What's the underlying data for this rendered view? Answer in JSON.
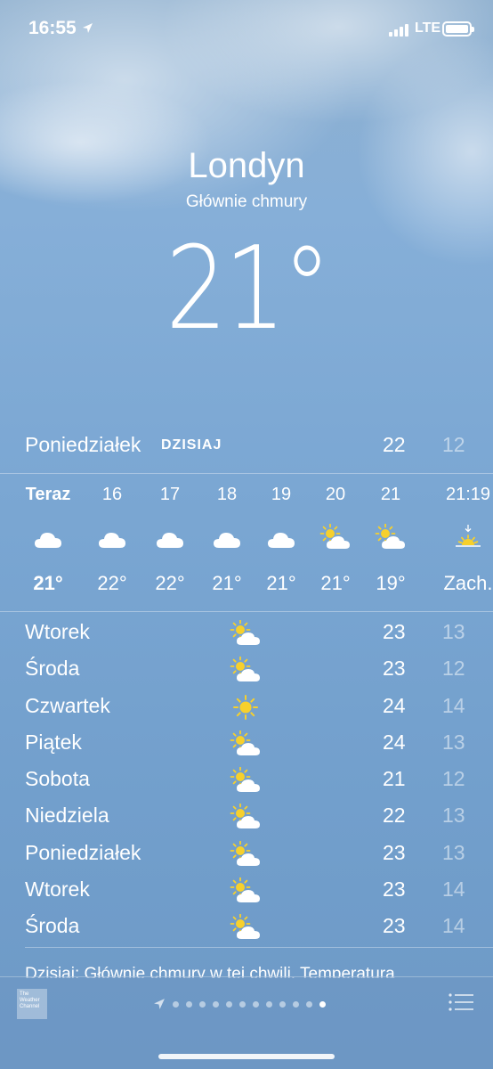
{
  "status_bar": {
    "time": "16:55",
    "network": "LTE"
  },
  "location": {
    "city": "Londyn",
    "condition": "Głównie chmury",
    "temperature": "21°"
  },
  "today": {
    "day": "Poniedziałek",
    "tag": "DZISIAJ",
    "high": "22",
    "low": "12"
  },
  "hourly": [
    {
      "label": "Teraz",
      "icon": "cloud-icon",
      "temp": "21°",
      "bold": true
    },
    {
      "label": "16",
      "icon": "cloud-icon",
      "temp": "22°"
    },
    {
      "label": "17",
      "icon": "cloud-icon",
      "temp": "22°"
    },
    {
      "label": "18",
      "icon": "cloud-icon",
      "temp": "21°"
    },
    {
      "label": "19",
      "icon": "cloud-icon",
      "temp": "21°"
    },
    {
      "label": "20",
      "icon": "partly-cloudy-icon",
      "temp": "21°"
    },
    {
      "label": "21",
      "icon": "partly-cloudy-icon",
      "temp": "19°"
    },
    {
      "label": "21:19",
      "icon": "sunset-icon",
      "temp": "Zach."
    }
  ],
  "daily": [
    {
      "day": "Wtorek",
      "icon": "partly-cloudy-icon",
      "high": "23",
      "low": "13"
    },
    {
      "day": "Środa",
      "icon": "partly-cloudy-icon",
      "high": "23",
      "low": "12"
    },
    {
      "day": "Czwartek",
      "icon": "sun-icon",
      "high": "24",
      "low": "14"
    },
    {
      "day": "Piątek",
      "icon": "partly-cloudy-icon",
      "high": "24",
      "low": "13"
    },
    {
      "day": "Sobota",
      "icon": "partly-cloudy-icon",
      "high": "21",
      "low": "12"
    },
    {
      "day": "Niedziela",
      "icon": "partly-cloudy-icon",
      "high": "22",
      "low": "13"
    },
    {
      "day": "Poniedziałek",
      "icon": "partly-cloudy-icon",
      "high": "23",
      "low": "13"
    },
    {
      "day": "Wtorek",
      "icon": "partly-cloudy-icon",
      "high": "23",
      "low": "14"
    },
    {
      "day": "Środa",
      "icon": "partly-cloudy-icon",
      "high": "23",
      "low": "14"
    }
  ],
  "summary": "Dzisiaj: Głównie chmury w tej chwili. Temperatura",
  "bottom_bar": {
    "provider_logo": [
      "The",
      "Weather",
      "Channel"
    ],
    "page_count": 12,
    "active_page": 12
  },
  "colors": {
    "sun": "#f7d02c",
    "cloud": "#ffffff",
    "sky_top": "#8fb0cf",
    "sky_bottom": "#6d99c6"
  }
}
